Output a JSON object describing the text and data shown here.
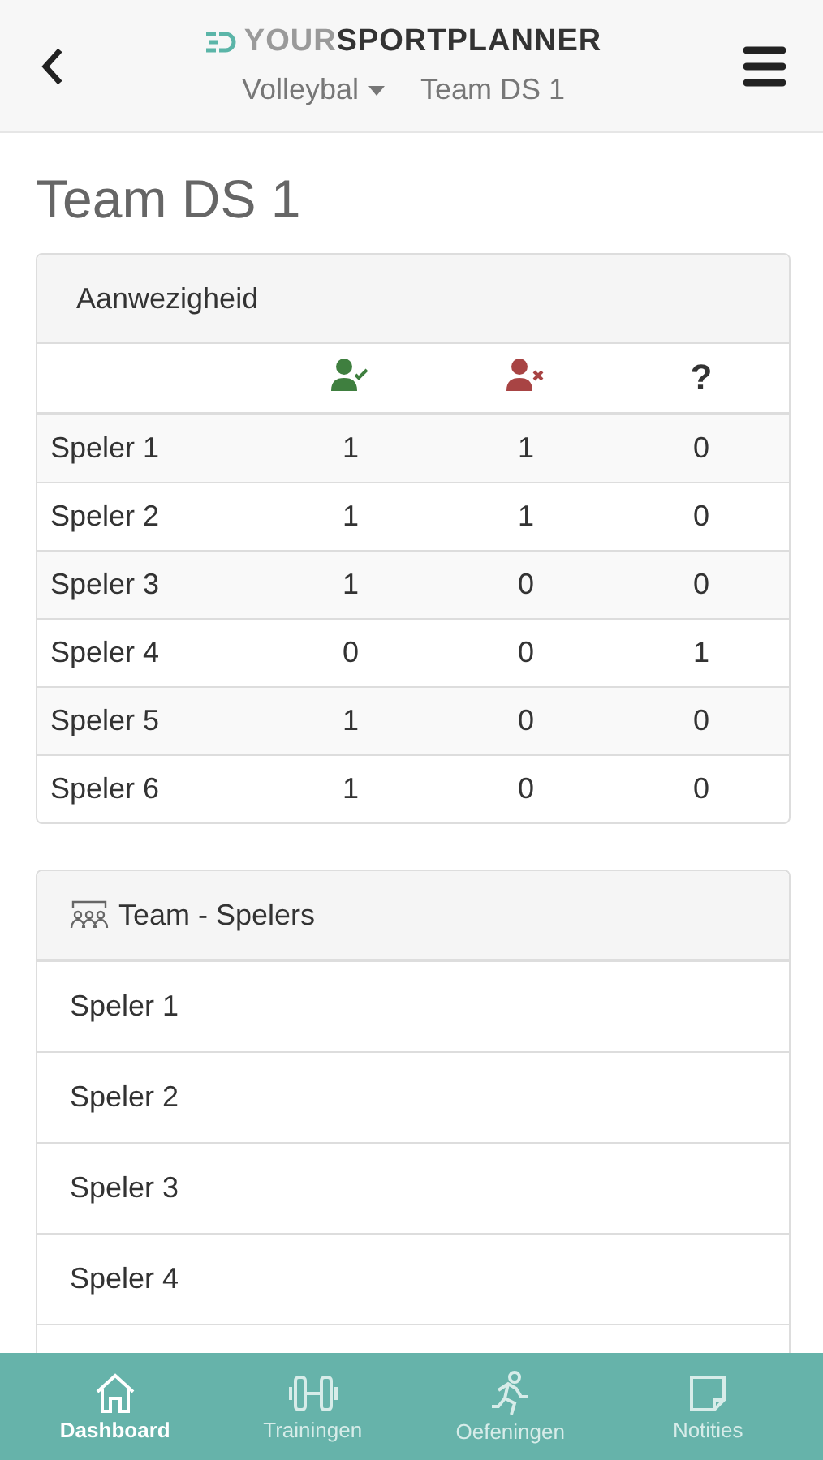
{
  "header": {
    "logo": "YOUR**SPORTPLANNER**",
    "sport": "Volleybal",
    "team": "Team DS 1"
  },
  "page_title": "Team DS 1",
  "attendance": {
    "title": "Aanwezigheid",
    "columns": [
      {
        "kind": "present"
      },
      {
        "kind": "absent"
      },
      {
        "kind": "unknown",
        "label": "?"
      }
    ],
    "rows": [
      {
        "name": "Speler 1",
        "values": [
          "1",
          "1",
          "0"
        ]
      },
      {
        "name": "Speler 2",
        "values": [
          "1",
          "1",
          "0"
        ]
      },
      {
        "name": "Speler 3",
        "values": [
          "1",
          "0",
          "0"
        ]
      },
      {
        "name": "Speler 4",
        "values": [
          "0",
          "0",
          "1"
        ]
      },
      {
        "name": "Speler 5",
        "values": [
          "1",
          "0",
          "0"
        ]
      },
      {
        "name": "Speler 6",
        "values": [
          "1",
          "0",
          "0"
        ]
      }
    ]
  },
  "players": {
    "title": "Team - Spelers",
    "items": [
      "Speler 1",
      "Speler 2",
      "Speler 3",
      "Speler 4"
    ]
  },
  "bottom_nav": [
    {
      "kind": "home",
      "label": "Dashboard",
      "selected": true
    },
    {
      "kind": "dumbbell",
      "label": "Trainingen",
      "selected": false
    },
    {
      "kind": "runner",
      "label": "Oefeningen",
      "selected": false
    },
    {
      "kind": "note",
      "label": "Notities",
      "selected": false
    }
  ]
}
